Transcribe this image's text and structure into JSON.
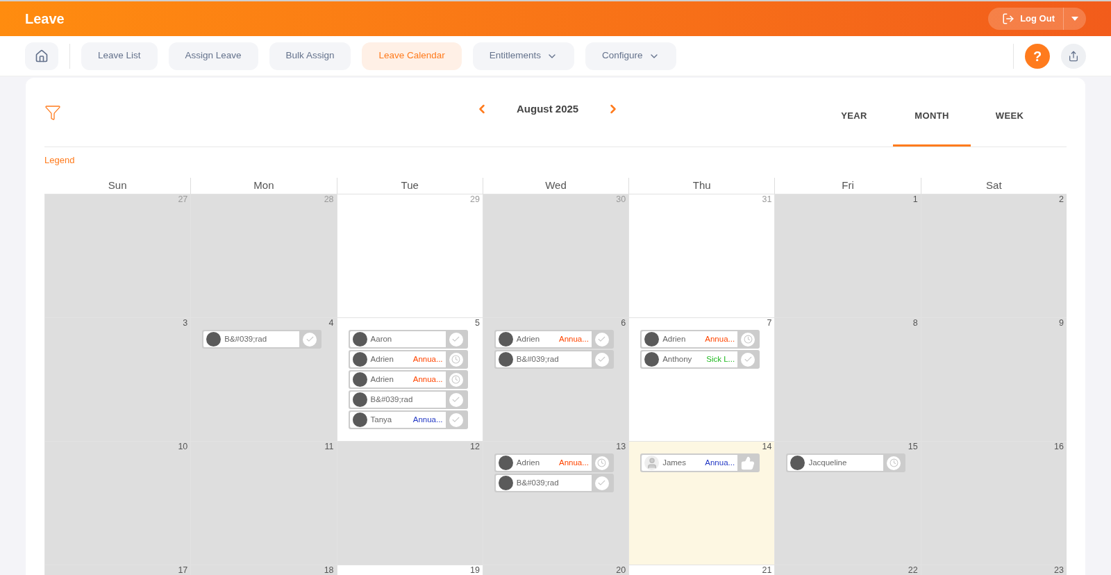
{
  "header": {
    "title": "Leave",
    "logout": "Log Out"
  },
  "nav": [
    {
      "label": "Leave List",
      "selected": false,
      "dropdown": false
    },
    {
      "label": "Assign Leave",
      "selected": false,
      "dropdown": false
    },
    {
      "label": "Bulk Assign",
      "selected": false,
      "dropdown": false
    },
    {
      "label": "Leave Calendar",
      "selected": true,
      "dropdown": false
    },
    {
      "label": "Entitlements",
      "selected": false,
      "dropdown": true
    },
    {
      "label": "Configure",
      "selected": false,
      "dropdown": true
    }
  ],
  "help": "?",
  "calendar": {
    "period": "August 2025",
    "legend": "Legend",
    "views": [
      {
        "label": "YEAR",
        "selected": false
      },
      {
        "label": "MONTH",
        "selected": true
      },
      {
        "label": "WEEK",
        "selected": false
      }
    ],
    "weekdays": [
      "Sun",
      "Mon",
      "Tue",
      "Wed",
      "Thu",
      "Fri",
      "Sat"
    ],
    "weeks": [
      [
        {
          "day": "27",
          "kind": "off",
          "outside": true
        },
        {
          "day": "28",
          "kind": "off",
          "outside": true
        },
        {
          "day": "29",
          "kind": "work",
          "outside": true
        },
        {
          "day": "30",
          "kind": "off",
          "outside": true
        },
        {
          "day": "31",
          "kind": "work",
          "outside": true
        },
        {
          "day": "1",
          "kind": "off",
          "outside": false
        },
        {
          "day": "2",
          "kind": "off",
          "outside": false
        }
      ],
      [
        {
          "day": "3",
          "kind": "off",
          "outside": false
        },
        {
          "day": "4",
          "kind": "off",
          "outside": false,
          "entries": [
            {
              "name": "B&#039;rad",
              "photo": true,
              "kind": "approved"
            }
          ]
        },
        {
          "day": "5",
          "kind": "work",
          "outside": false,
          "entries": [
            {
              "name": "Aaron",
              "photo": true,
              "kind": "approved"
            },
            {
              "name": "Adrien",
              "type": "Annua...",
              "color": "#ff4500",
              "photo": true,
              "kind": "pending"
            },
            {
              "name": "Adrien",
              "type": "Annua...",
              "color": "#ff4500",
              "photo": true,
              "kind": "pending"
            },
            {
              "name": "B&#039;rad",
              "photo": true,
              "kind": "approved"
            },
            {
              "name": "Tanya",
              "type": "Annua...",
              "color": "#2238c4",
              "photo": true,
              "kind": "approved"
            }
          ]
        },
        {
          "day": "6",
          "kind": "off",
          "outside": false,
          "entries": [
            {
              "name": "Adrien",
              "type": "Annua...",
              "color": "#ff4500",
              "photo": true,
              "kind": "approved"
            },
            {
              "name": "B&#039;rad",
              "photo": true,
              "kind": "approved"
            }
          ]
        },
        {
          "day": "7",
          "kind": "work",
          "outside": false,
          "entries": [
            {
              "name": "Adrien",
              "type": "Annua...",
              "color": "#ff4500",
              "photo": true,
              "kind": "pending"
            },
            {
              "name": "Anthony",
              "type": "Sick L...",
              "color": "#1fb81f",
              "photo": true,
              "kind": "approved"
            }
          ]
        },
        {
          "day": "8",
          "kind": "off",
          "outside": false
        },
        {
          "day": "9",
          "kind": "off",
          "outside": false
        }
      ],
      [
        {
          "day": "10",
          "kind": "off",
          "outside": false
        },
        {
          "day": "11",
          "kind": "off",
          "outside": false
        },
        {
          "day": "12",
          "kind": "off",
          "outside": false
        },
        {
          "day": "13",
          "kind": "off",
          "outside": false,
          "entries": [
            {
              "name": "Adrien",
              "type": "Annua...",
              "color": "#ff4500",
              "photo": true,
              "kind": "pending"
            },
            {
              "name": "B&#039;rad",
              "photo": true,
              "kind": "approved"
            }
          ]
        },
        {
          "day": "14",
          "kind": "today",
          "outside": false,
          "entries": [
            {
              "name": "James",
              "type": "Annua...",
              "color": "#2238c4",
              "photo": false,
              "kind": "taken"
            }
          ]
        },
        {
          "day": "15",
          "kind": "off",
          "outside": false,
          "entries": [
            {
              "name": "Jacqueline",
              "photo": true,
              "kind": "pending"
            }
          ]
        },
        {
          "day": "16",
          "kind": "off",
          "outside": false
        }
      ],
      [
        {
          "day": "17",
          "kind": "off",
          "outside": false
        },
        {
          "day": "18",
          "kind": "off",
          "outside": false
        },
        {
          "day": "19",
          "kind": "work",
          "outside": false
        },
        {
          "day": "20",
          "kind": "off",
          "outside": false
        },
        {
          "day": "21",
          "kind": "work",
          "outside": false
        },
        {
          "day": "22",
          "kind": "off",
          "outside": false
        },
        {
          "day": "23",
          "kind": "off",
          "outside": false
        }
      ]
    ]
  }
}
